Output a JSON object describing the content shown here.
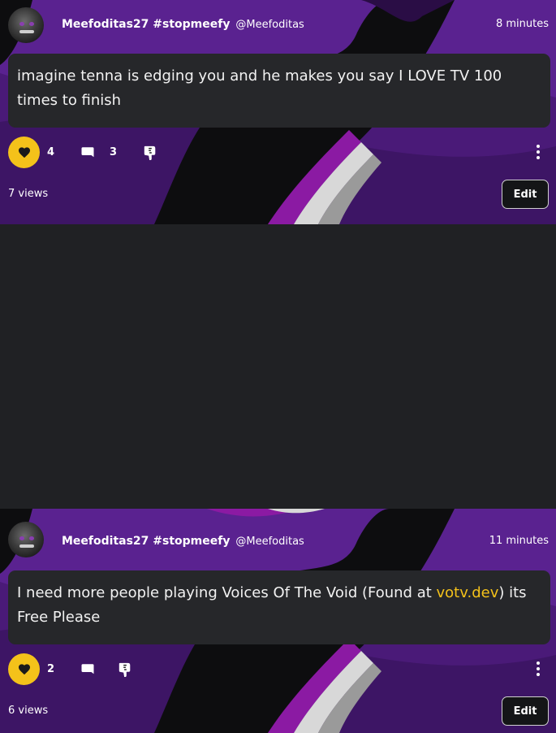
{
  "colors": {
    "accent": "#f4c21a",
    "page_background": "#202124",
    "card_background": "#26272a",
    "banner_purple": "#5a1f8c",
    "banner_dark": "#3a1560"
  },
  "posts": [
    {
      "author_name": "Meefoditas27 #stopmeefy",
      "handle": "@Meefoditas",
      "time": "8 minutes",
      "content": "imagine tenna is edging you and he makes you say I LOVE TV 100 times to finish",
      "like_icon": "heart-icon",
      "like_count": "4",
      "comment_icon": "comment-icon",
      "comment_count": "3",
      "reaction_icon": "thumbs-down-icon",
      "more_icon": "more-vertical-icon",
      "views": "7 views",
      "edit_label": "Edit"
    },
    {
      "author_name": "Meefoditas27 #stopmeefy",
      "handle": "@Meefoditas",
      "time": "11 minutes",
      "content_before_link": "I need more people playing Voices Of The Void (Found at ",
      "content_link": "votv.dev",
      "content_after_link": ") its Free Please",
      "like_icon": "heart-icon",
      "like_count": "2",
      "comment_icon": "comment-icon",
      "reaction_icon": "thumbs-down-icon",
      "more_icon": "more-vertical-icon",
      "views": "6 views",
      "edit_label": "Edit"
    }
  ]
}
